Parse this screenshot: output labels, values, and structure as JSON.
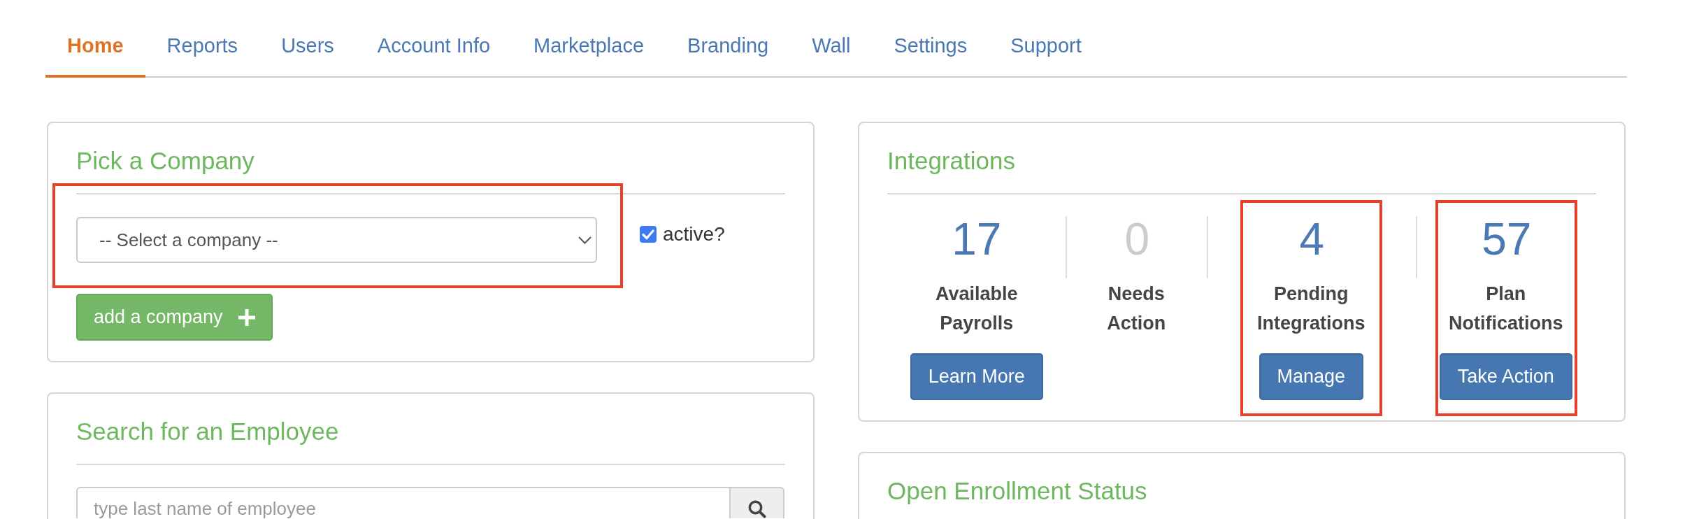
{
  "nav": {
    "tabs": [
      {
        "label": "Home",
        "selected": true
      },
      {
        "label": "Reports",
        "selected": false
      },
      {
        "label": "Users",
        "selected": false
      },
      {
        "label": "Account Info",
        "selected": false
      },
      {
        "label": "Marketplace",
        "selected": false
      },
      {
        "label": "Branding",
        "selected": false
      },
      {
        "label": "Wall",
        "selected": false
      },
      {
        "label": "Settings",
        "selected": false
      },
      {
        "label": "Support",
        "selected": false
      }
    ]
  },
  "company_picker": {
    "title": "Pick a Company",
    "highlighted": true,
    "select": {
      "value": "-- Select a company --"
    },
    "active_filter": {
      "label": "active?",
      "checked": true
    },
    "add_button": {
      "label": "add a company"
    }
  },
  "integrations": {
    "title": "Integrations",
    "stats": [
      {
        "count": "17",
        "label": "Available Payrolls",
        "dimmed": false,
        "highlighted": false,
        "button": "Learn More"
      },
      {
        "count": "0",
        "label": "Needs Action",
        "dimmed": true,
        "highlighted": false
      },
      {
        "count": "4",
        "label": "Pending Integrations",
        "dimmed": false,
        "highlighted": true,
        "button": "Manage"
      },
      {
        "count": "57",
        "label": "Plan Notifications",
        "dimmed": false,
        "highlighted": true,
        "button": "Take Action"
      }
    ]
  },
  "employee_search": {
    "title": "Search for an Employee",
    "search_field": {
      "placeholder": "type last name of employee"
    }
  },
  "open_enrollment": {
    "title": "Open Enrollment Status"
  }
}
